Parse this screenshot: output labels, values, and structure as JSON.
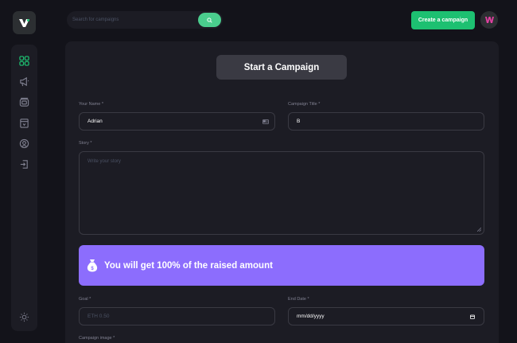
{
  "header": {
    "search_placeholder": "Search for campaigns",
    "create_label": "Create a campaign"
  },
  "form": {
    "heading": "Start a Campaign",
    "name_label": "Your Name *",
    "name_value": "Adrian",
    "title_label": "Campaign Title *",
    "title_value": "B",
    "story_label": "Story *",
    "story_placeholder": "Write your story",
    "banner_text": "You will get 100% of the raised amount",
    "goal_label": "Goal *",
    "goal_placeholder": "ETH 0.50",
    "end_date_label": "End Date *",
    "end_date_value": "mm/dd/yyyy",
    "image_label": "Campaign image *"
  },
  "colors": {
    "accent_green": "#1dc071",
    "banner_purple": "#8c6dfd",
    "background": "#13131a",
    "card": "#1c1c24"
  },
  "icons": {
    "sidebar": [
      "dashboard-icon",
      "campaign-icon",
      "payment-icon",
      "withdraw-icon",
      "profile-icon",
      "logout-icon"
    ],
    "footer": "sun-icon"
  }
}
